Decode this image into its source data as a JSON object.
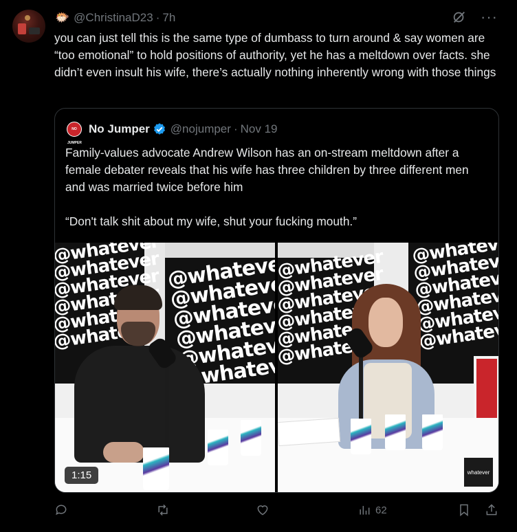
{
  "post": {
    "handle": "@ChristinaD23",
    "separator": "·",
    "time": "7h",
    "text": "you can just tell this is the same type of dumbass to turn around & say women are “too emotional” to hold positions of authority, yet he has a meltdown over facts. she didn’t even insult his wife, there’s actually nothing inherently wrong with those things"
  },
  "quote": {
    "avatar_text": "NO JUMPER",
    "name": "No Jumper",
    "handle": "@nojumper",
    "separator": "·",
    "date": "Nov 19",
    "paragraph1": "Family-values advocate Andrew Wilson has an on-stream meltdown after a female debater reveals that his wife has three children by three different men and was married twice before him",
    "paragraph2": "“Don't talk shit about my wife, shut your fucking mouth.”",
    "video_duration": "1:15",
    "watermark_text": "@whatever",
    "channel_logo": "whatever"
  },
  "actions": {
    "views": "62"
  },
  "icons": [
    "reply-icon",
    "repost-icon",
    "like-icon",
    "views-icon",
    "bookmark-icon",
    "share-icon",
    "grok-icon",
    "more-icon",
    "verified-icon"
  ],
  "colors": {
    "background": "#000000",
    "text": "#e7e9ea",
    "muted": "#71767b",
    "verified": "#1d9bf0",
    "border": "#2f3336"
  }
}
